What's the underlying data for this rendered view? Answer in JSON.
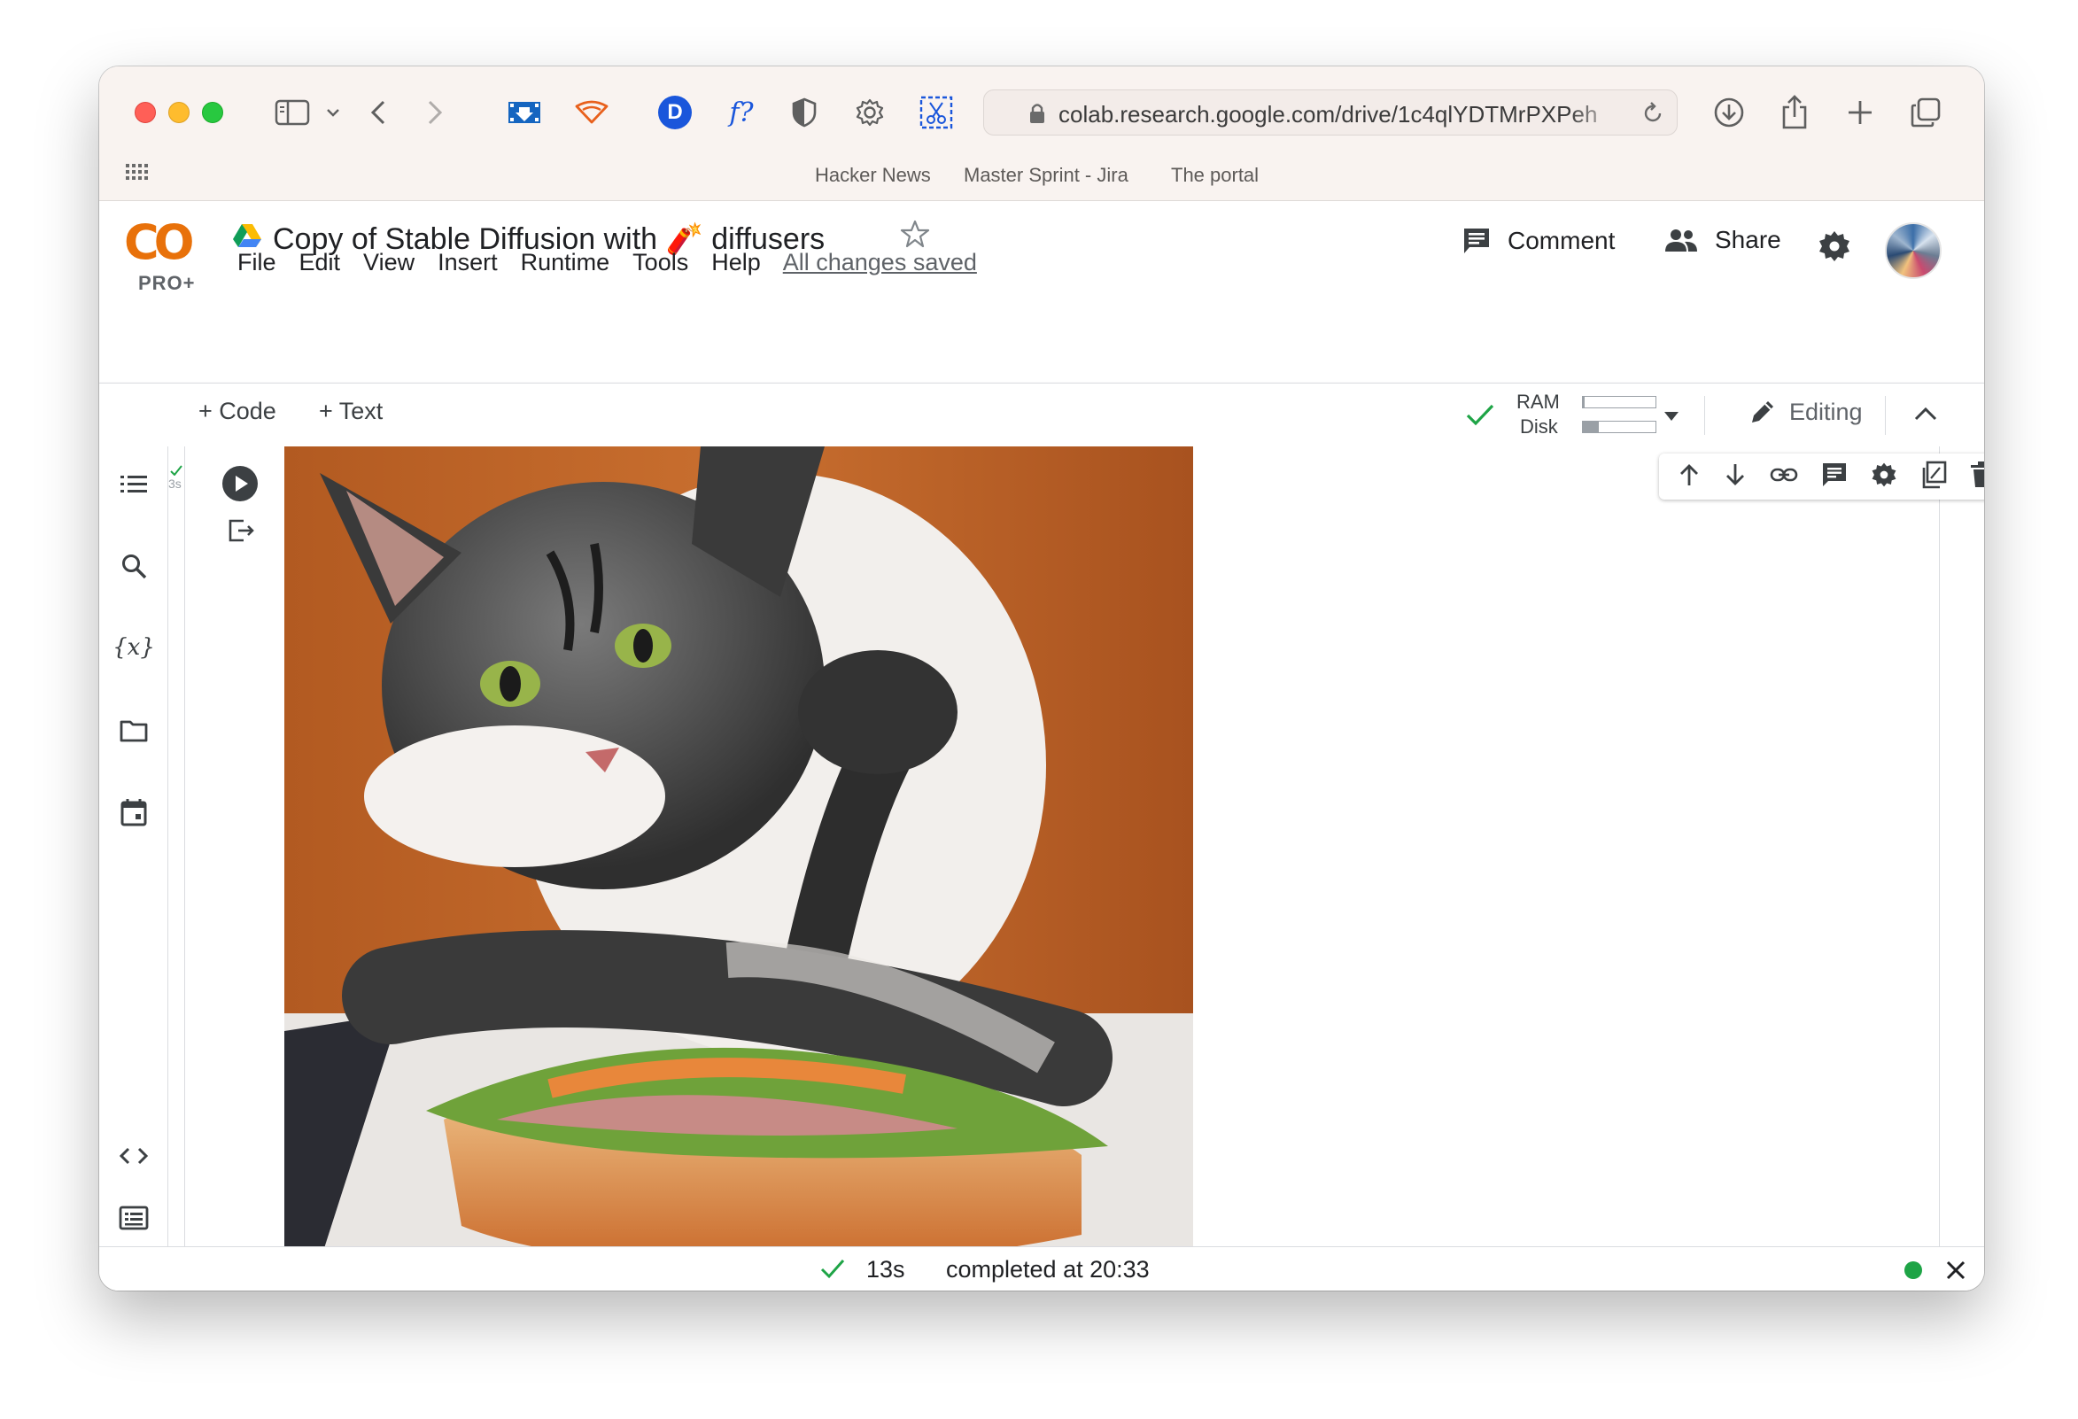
{
  "browser": {
    "url": "colab.research.google.com/drive/1c4qlYDTMrPXPeh",
    "favorites": [
      "Hacker News",
      "Master Sprint - Jira",
      "The portal"
    ],
    "extension_d_letter": "D",
    "extension_f_label": "f?"
  },
  "colab": {
    "logo_text": "CO",
    "pro_label": "PRO+",
    "doc_title": "Copy of Stable Diffusion with 🧨 diffusers",
    "menu": [
      "File",
      "Edit",
      "View",
      "Insert",
      "Runtime",
      "Tools",
      "Help"
    ],
    "save_status": "All changes saved",
    "comment_label": "Comment",
    "share_label": "Share"
  },
  "toolbar": {
    "add_code": "+ Code",
    "add_text": "+ Text",
    "ram_label": "RAM",
    "disk_label": "Disk",
    "ram_usage": 0.02,
    "disk_usage": 0.22,
    "editing_label": "Editing"
  },
  "cell": {
    "exec_time_hint": "3s",
    "output_image": "cat-with-sandwich"
  },
  "status_bar": {
    "duration": "13s",
    "completed_text": "completed at 20:33"
  },
  "colors": {
    "accent_orange": "#e8710a",
    "accent_yellow": "#f9ab00",
    "success_green": "#1ea446"
  }
}
